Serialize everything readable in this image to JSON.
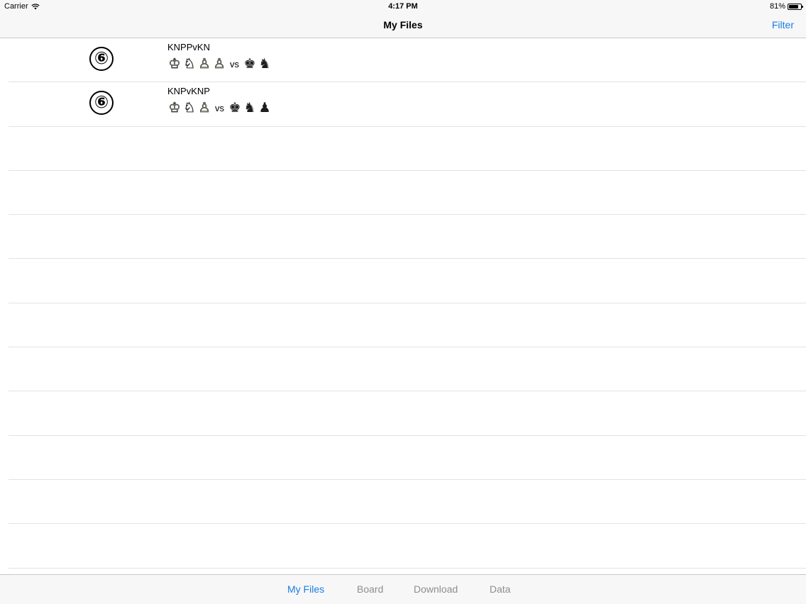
{
  "status_bar": {
    "carrier": "Carrier",
    "time": "4:17 PM",
    "battery": "81%",
    "battery_level": 0.81
  },
  "nav": {
    "title": "My Files",
    "filter_label": "Filter"
  },
  "files": [
    {
      "badge": "⑥",
      "name": "KNPPvKN",
      "white_pieces": [
        "♔",
        "♘",
        "♙",
        "♙"
      ],
      "vs": "vs",
      "black_pieces": [
        "♚",
        "♞"
      ]
    },
    {
      "badge": "⑥",
      "name": "KNPvKNP",
      "white_pieces": [
        "♔",
        "♘",
        "♙"
      ],
      "vs": "vs",
      "black_pieces": [
        "♚",
        "♞",
        "♟"
      ]
    }
  ],
  "tabs": [
    {
      "label": "My Files",
      "active": true
    },
    {
      "label": "Board",
      "active": false
    },
    {
      "label": "Download",
      "active": false
    },
    {
      "label": "Data",
      "active": false
    }
  ],
  "colors": {
    "accent": "#1a7ee6",
    "inactive_tab": "#8e8e93",
    "bar_background": "#f7f7f7",
    "separator": "#e2e1e6"
  }
}
